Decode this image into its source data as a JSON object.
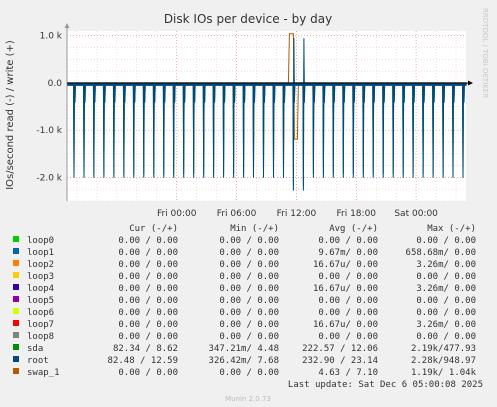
{
  "chart_data": {
    "type": "line",
    "title": "Disk IOs per device - by day",
    "ylabel": "IOs/second read (-) / write (+)",
    "side_label": "RRDTOOL / TOBI OETIKER",
    "ylim": [
      -2500,
      1100
    ],
    "y_ticks": [
      {
        "value": 1000,
        "label": "1.0 k"
      },
      {
        "value": 0,
        "label": "0.0"
      },
      {
        "value": -1000,
        "label": "-1.0 k"
      },
      {
        "value": -2000,
        "label": "-2.0 k"
      }
    ],
    "x_ticks": [
      {
        "hours": 11,
        "label": "Fri 00:00"
      },
      {
        "hours": 17,
        "label": "Fri 06:00"
      },
      {
        "hours": 23,
        "label": "Fri 12:00"
      },
      {
        "hours": 29,
        "label": "Fri 18:00"
      },
      {
        "hours": 35,
        "label": "Sat 00:00"
      }
    ],
    "x_range_hours": [
      0,
      40
    ],
    "grid": true,
    "spikes": {
      "root_read_peak": -2280,
      "root_write_peak": 948.97,
      "sda_read_peak": -2190,
      "sda_write_peak": 477.93,
      "swap_1_read_peak": -1190,
      "swap_1_write_peak": 1040,
      "spike_interval_minutes": 60
    },
    "headers": {
      "cur": "Cur (-/+)",
      "min": "Min (-/+)",
      "avg": "Avg (-/+)",
      "max": "Max (-/+)"
    },
    "series": [
      {
        "name": "loop0",
        "color": "#00cc00",
        "cur": "0.00 /  0.00",
        "min": "0.00 /  0.00",
        "avg": "0.00 /  0.00",
        "max": "0.00 /  0.00"
      },
      {
        "name": "loop1",
        "color": "#0066b3",
        "cur": "0.00 /  0.00",
        "min": "0.00 /  0.00",
        "avg": "9.67m/  0.00",
        "max": "658.68m/  0.00"
      },
      {
        "name": "loop2",
        "color": "#ff8000",
        "cur": "0.00 /  0.00",
        "min": "0.00 /  0.00",
        "avg": "16.67u/  0.00",
        "max": "3.26m/  0.00"
      },
      {
        "name": "loop3",
        "color": "#ffcc00",
        "cur": "0.00 /  0.00",
        "min": "0.00 /  0.00",
        "avg": "0.00 /  0.00",
        "max": "0.00 /  0.00"
      },
      {
        "name": "loop4",
        "color": "#330099",
        "cur": "0.00 /  0.00",
        "min": "0.00 /  0.00",
        "avg": "16.67u/  0.00",
        "max": "3.26m/  0.00"
      },
      {
        "name": "loop5",
        "color": "#990099",
        "cur": "0.00 /  0.00",
        "min": "0.00 /  0.00",
        "avg": "0.00 /  0.00",
        "max": "0.00 /  0.00"
      },
      {
        "name": "loop6",
        "color": "#ccff00",
        "cur": "0.00 /  0.00",
        "min": "0.00 /  0.00",
        "avg": "0.00 /  0.00",
        "max": "0.00 /  0.00"
      },
      {
        "name": "loop7",
        "color": "#ff0000",
        "cur": "0.00 /  0.00",
        "min": "0.00 /  0.00",
        "avg": "16.67u/  0.00",
        "max": "3.26m/  0.00"
      },
      {
        "name": "loop8",
        "color": "#808080",
        "cur": "0.00 /  0.00",
        "min": "0.00 /  0.00",
        "avg": "0.00 /  0.00",
        "max": "0.00 /  0.00"
      },
      {
        "name": "sda",
        "color": "#008f00",
        "cur": "82.34 /  8.62",
        "min": "347.21m/  4.48",
        "avg": "222.57 / 12.06",
        "max": "2.19k/477.93"
      },
      {
        "name": "root",
        "color": "#00487d",
        "cur": "82.48 / 12.59",
        "min": "326.42m/  7.68",
        "avg": "232.90 / 23.14",
        "max": "2.28k/948.97"
      },
      {
        "name": "swap_1",
        "color": "#b35a00",
        "cur": "0.00 /  0.00",
        "min": "0.00 /  0.00",
        "avg": "4.63 /  7.10",
        "max": "1.19k/  1.04k"
      }
    ],
    "last_update": "Last update: Sat Dec  6 05:00:08 2025",
    "footer": "Munin 2.0.73"
  }
}
